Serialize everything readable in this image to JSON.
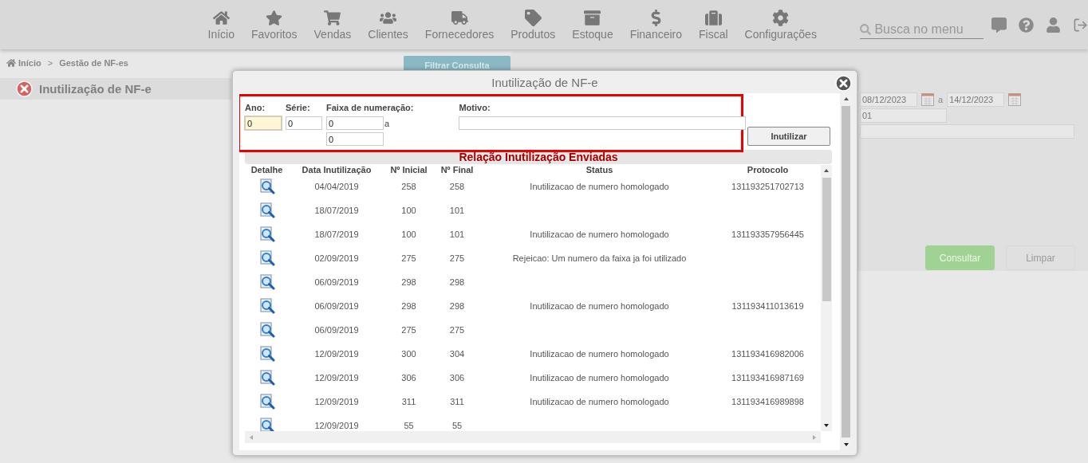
{
  "nav": {
    "items": [
      {
        "label": "Início"
      },
      {
        "label": "Favoritos"
      },
      {
        "label": "Vendas"
      },
      {
        "label": "Clientes"
      },
      {
        "label": "Fornecedores"
      },
      {
        "label": "Produtos"
      },
      {
        "label": "Estoque"
      },
      {
        "label": "Financeiro"
      },
      {
        "label": "Fiscal"
      },
      {
        "label": "Configurações"
      }
    ],
    "search": {
      "placeholder": "Busca no menu"
    }
  },
  "breadcrumb": {
    "items": [
      "Início",
      "Gestão de NF-es"
    ],
    "separator": ">"
  },
  "page_title": "Inutilização de NF-e",
  "filter_button": "Filtrar Consulta",
  "filters": {
    "date_from": "08/12/2023",
    "date_separator": "a",
    "date_to": "14/12/2023",
    "field_2": "01"
  },
  "buttons": [
    {
      "label": "Consultar",
      "kind": "primary"
    },
    {
      "label": "Limpar",
      "kind": "secondary"
    }
  ],
  "dialog": {
    "title": "Inutilização de NF-e",
    "form": {
      "ano": {
        "label": "Ano:",
        "value": "0",
        "focused": true
      },
      "serie": {
        "label": "Série:",
        "value": "0",
        "focused": false
      },
      "faixa": {
        "label": "Faixa de numeração:",
        "from": "0",
        "separator": "a",
        "to": "0"
      },
      "motivo": {
        "label": "Motivo:"
      },
      "submit": "Inutilizar"
    },
    "section_title": "Relação Inutilização Enviadas",
    "columns": [
      "Detalhe",
      "Data Inutilização",
      "Nº Inicial",
      "Nº Final",
      "Status",
      "Protocolo"
    ],
    "rows": [
      {
        "date": "04/04/2019",
        "start": "258",
        "end": "258",
        "status": "Inutilizacao de numero homologado",
        "protocol": "131193251702713"
      },
      {
        "date": "18/07/2019",
        "start": "100",
        "end": "101"
      },
      {
        "date": "18/07/2019",
        "start": "100",
        "end": "101",
        "status": "Inutilizacao de numero homologado",
        "protocol": "131193357956445"
      },
      {
        "date": "02/09/2019",
        "start": "275",
        "end": "275",
        "status": "Rejeicao: Um numero da faixa ja foi utilizado"
      },
      {
        "date": "06/09/2019",
        "start": "298",
        "end": "298"
      },
      {
        "date": "06/09/2019",
        "start": "298",
        "end": "298",
        "status": "Inutilizacao de numero homologado",
        "protocol": "131193411013619"
      },
      {
        "date": "06/09/2019",
        "start": "275",
        "end": "275"
      },
      {
        "date": "12/09/2019",
        "start": "300",
        "end": "304",
        "status": "Inutilizacao de numero homologado",
        "protocol": "131193416982006"
      },
      {
        "date": "12/09/2019",
        "start": "306",
        "end": "306",
        "status": "Inutilizacao de numero homologado",
        "protocol": "131193416987169"
      },
      {
        "date": "12/09/2019",
        "start": "311",
        "end": "311",
        "status": "Inutilizacao de numero homologado",
        "protocol": "131193416989898"
      },
      {
        "date": "12/09/2019",
        "start": "55",
        "end": "55"
      }
    ]
  }
}
